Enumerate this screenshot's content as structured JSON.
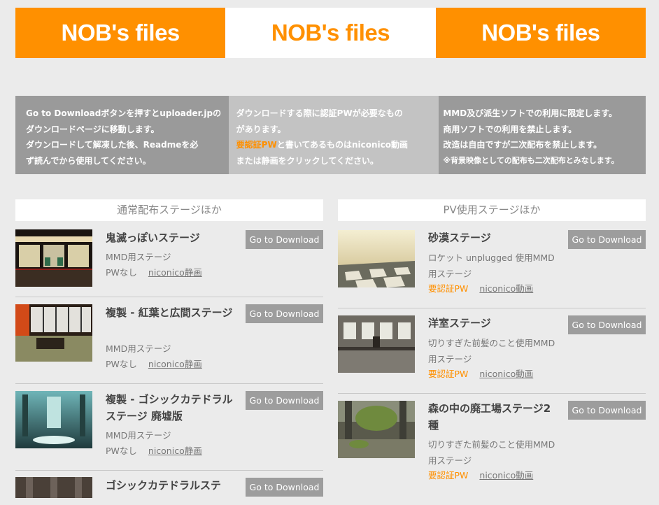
{
  "banners": [
    {
      "text": "NOB's files",
      "style": "orange"
    },
    {
      "text": "NOB's files",
      "style": "white"
    },
    {
      "text": "NOB's files",
      "style": "orange"
    }
  ],
  "info": {
    "box1": [
      "Go to Downloadボタンを押すとuploader.jpの",
      "ダウンロードページに移動します。",
      "ダウンロードして解凍した後、Readmeを必",
      "ず読んでから使用してください。"
    ],
    "box2": {
      "line1": "ダウンロードする際に認証PWが必要なもの",
      "line2": "があります。",
      "line3_hl": "要認証PW",
      "line3_rest": "と書いてあるものはniconico動画",
      "line4": "または静画をクリックしてください。"
    },
    "box3": [
      "MMD及び派生ソフトでの利用に限定します。",
      "商用ソフトでの利用を禁止します。",
      "改造は自由ですが二次配布を禁止します。",
      "※背景映像としての配布も二次配布とみなします。"
    ]
  },
  "left_column": {
    "header": "通常配布ステージほか",
    "items": [
      {
        "title": "鬼滅っぽいステージ",
        "desc": "MMD用ステージ",
        "pw": "PWなし",
        "link": "niconico静画",
        "button": "Go to Download"
      },
      {
        "title": "複製 - 紅葉と広間ステージ",
        "desc": "MMD用ステージ",
        "pw": "PWなし",
        "link": "niconico静画",
        "button": "Go to Download"
      },
      {
        "title": "複製 - ゴシックカテドラルステージ 廃墟版",
        "desc": "MMD用ステージ",
        "pw": "PWなし",
        "link": "niconico静画",
        "button": "Go to Download"
      },
      {
        "title": "ゴシックカテドラルステ",
        "desc": "",
        "pw": "",
        "link": "",
        "button": "Go to Download"
      }
    ]
  },
  "right_column": {
    "header": "PV使用ステージほか",
    "items": [
      {
        "title": "砂漠ステージ",
        "desc": "ロケット unplugged 使用MMD用ステージ",
        "pw": "要認証PW",
        "link": "niconico動画",
        "button": "Go to Download"
      },
      {
        "title": "洋室ステージ",
        "desc": "切りすぎた前髪のこと使用MMD用ステージ",
        "pw": "要認証PW",
        "link": "niconico動画",
        "button": "Go to Download"
      },
      {
        "title": "森の中の廃工場ステージ2種",
        "desc": "切りすぎた前髪のこと使用MMD用ステージ",
        "pw": "要認証PW",
        "link": "niconico動画",
        "button": "Go to Download"
      }
    ]
  },
  "colors": {
    "accent": "#ff9000",
    "gray_box": "#9a9a9a",
    "light_box": "#c3c3c3",
    "button": "#9d9d9d",
    "background": "#ebebeb"
  }
}
